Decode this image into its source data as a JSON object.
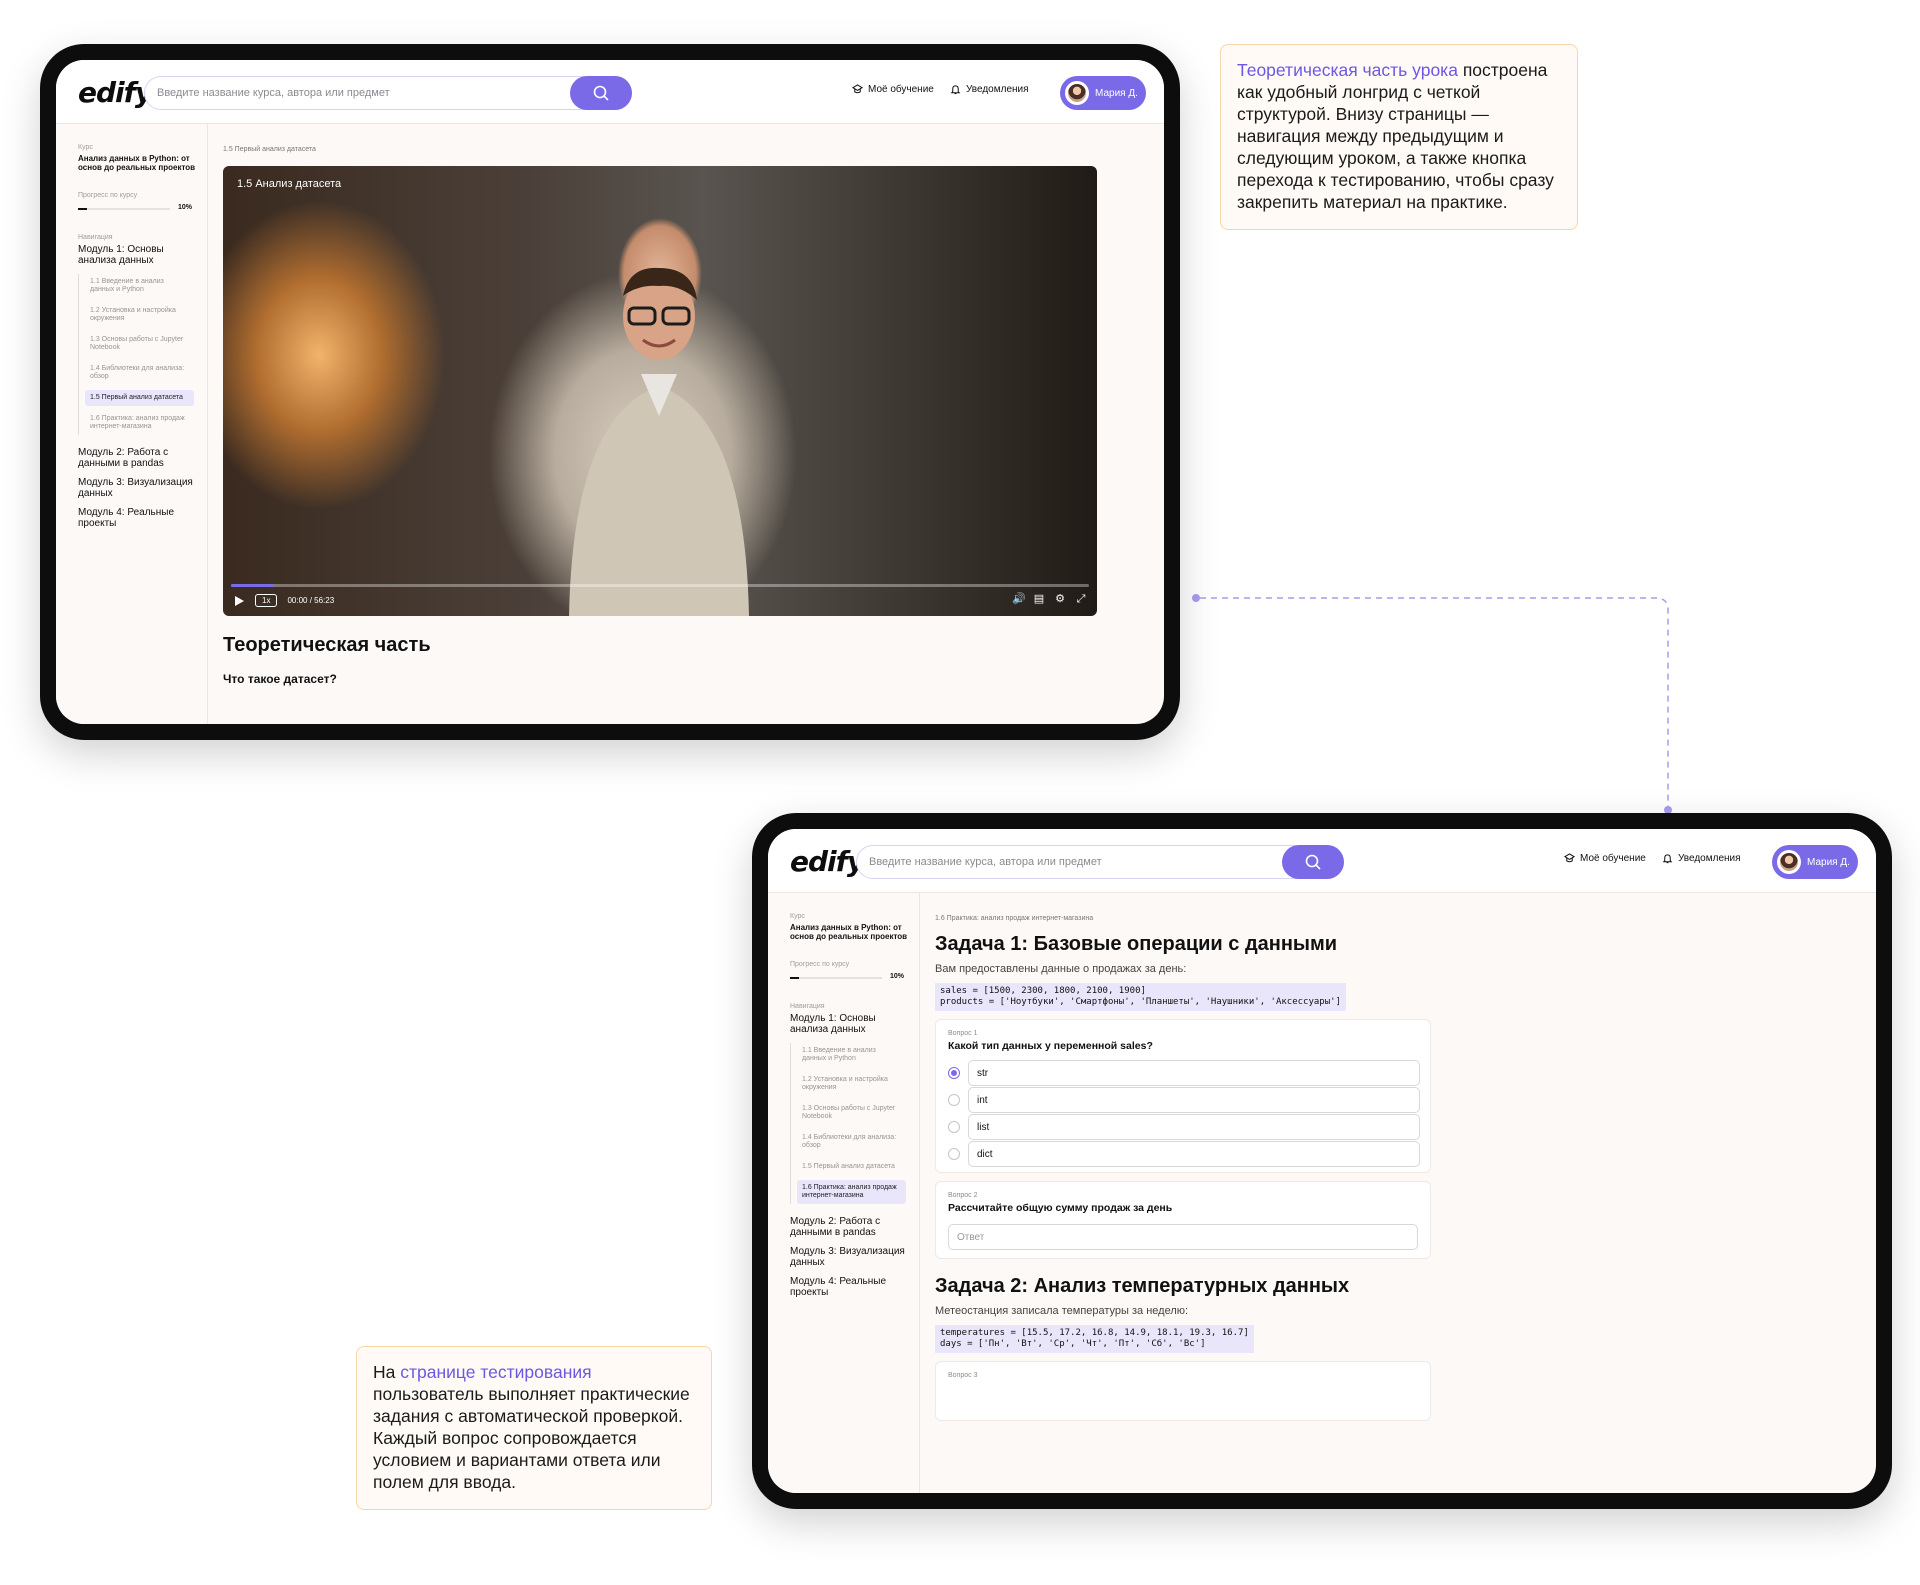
{
  "brand": {
    "logo": "edify",
    "accent": "#7b6ae8"
  },
  "header": {
    "search_placeholder": "Введите название курса, автора или предмет",
    "my_learning": "Моё обучение",
    "notifications": "Уведомления",
    "user_name": "Мария Д."
  },
  "sidebar": {
    "course_label": "Курс",
    "course_title": "Анализ данных в Python: от основ до реальных проектов",
    "progress_label": "Прогресс по курсу",
    "progress_value": "10%",
    "progress_fraction": 0.1,
    "nav_label": "Навигация",
    "module1": "Модуль 1: Основы анализа данных",
    "lessons": [
      "1.1 Введение в анализ данных и Python",
      "1.2 Установка и настройка окружения",
      "1.3 Основы работы с Jupyter Notebook",
      "1.4 Библиотеки для анализа: обзор",
      "1.5 Первый анализ датасета",
      "1.6 Практика: анализ продаж интернет-магазина"
    ],
    "module2": "Модуль 2: Работа с данными в pandas",
    "module3": "Модуль 3: Визуализация данных",
    "module4": "Модуль 4: Реальные проекты"
  },
  "lesson_page": {
    "breadcrumb": "1.5 Первый анализ датасета",
    "video_title": "1.5 Анализ датасета",
    "speed": "1x",
    "time": "00:00 / 56:23",
    "progress_fraction": 0.05,
    "section_title": "Теоретическая часть",
    "subsection_title": "Что такое датасет?"
  },
  "quiz_page": {
    "breadcrumb": "1.6 Практика: анализ продаж интернет-магазина",
    "task1_title": "Задача 1: Базовые операции с данными",
    "task1_desc": "Вам предоставлены данные о продажах за день:",
    "task1_code_line1": "sales = [1500, 2300, 1800, 2100, 1900]",
    "task1_code_line2": "products = ['Ноутбуки', 'Смартфоны', 'Планшеты', 'Наушники', 'Аксессуары']",
    "q1_label": "Вопрос 1",
    "q1_text": "Какой тип данных у переменной sales?",
    "q1_options": [
      "str",
      "int",
      "list",
      "dict"
    ],
    "q1_selected": "str",
    "q2_label": "Вопрос 2",
    "q2_text": "Рассчитайте общую сумму продаж за день",
    "q2_placeholder": "Ответ",
    "task2_title": "Задача 2: Анализ температурных данных",
    "task2_desc": "Метеостанция записала температуры за неделю:",
    "task2_code_line1": "temperatures = [15.5, 17.2, 16.8, 14.9, 18.1, 19.3, 16.7]",
    "task2_code_line2": "days = ['Пн', 'Вт', 'Ср', 'Чт', 'Пт', 'Сб', 'Вс']",
    "q3_label": "Вопрос 3"
  },
  "annotations": {
    "note1_highlight": "Теоретическая часть урока",
    "note1_text": " построена как удобный лонгрид с четкой структурой. Внизу страницы — навигация между предыдущим и следующим уроком, а также кнопка перехода к тестированию, чтобы сразу закрепить материал на практике.",
    "note2_prefix": "На ",
    "note2_highlight": "странице тестирования",
    "note2_text": " пользователь выполняет практические задания с автоматической проверкой. Каждый вопрос сопровождается условием и вариантами ответа или полем для ввода."
  }
}
